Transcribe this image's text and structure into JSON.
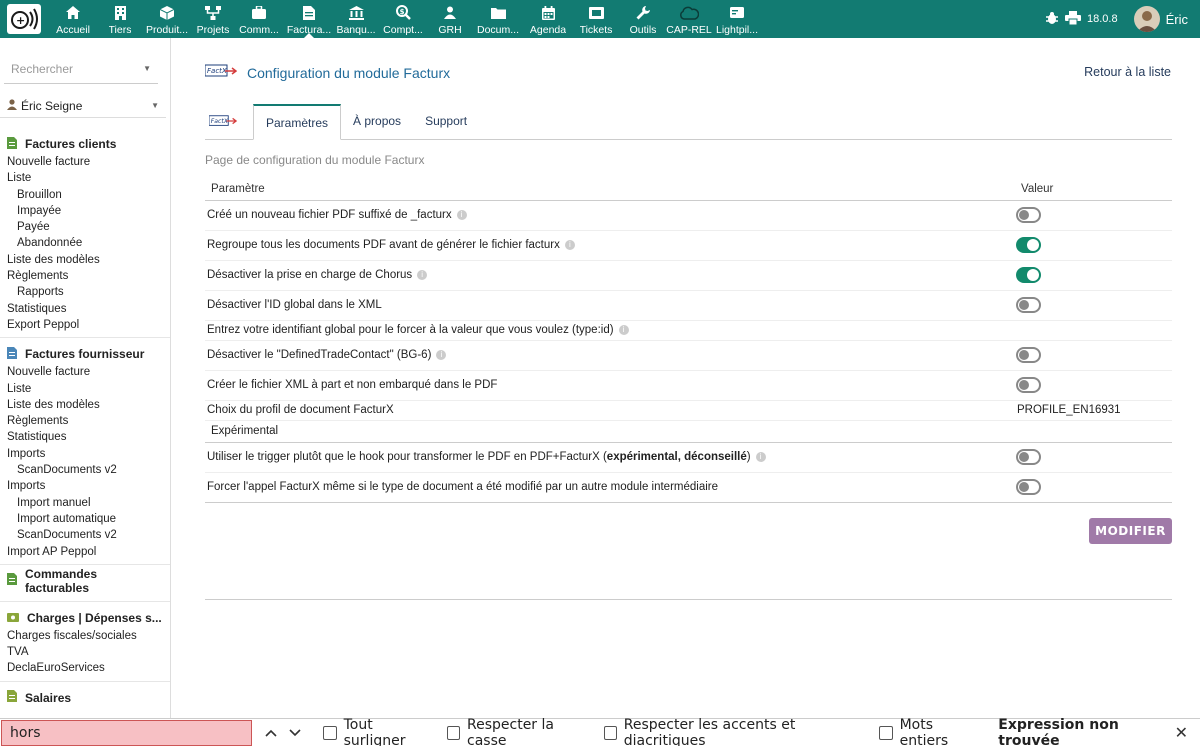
{
  "topbar": {
    "menu": [
      {
        "label": "Accueil",
        "icon": "home-icon"
      },
      {
        "label": "Tiers",
        "icon": "building-icon"
      },
      {
        "label": "Produit...",
        "icon": "cube-icon"
      },
      {
        "label": "Projets",
        "icon": "sitemap-icon"
      },
      {
        "label": "Comm...",
        "icon": "briefcase-icon"
      },
      {
        "label": "Factura...",
        "icon": "file-invoice-icon"
      },
      {
        "label": "Banqu...",
        "icon": "bank-icon"
      },
      {
        "label": "Compt...",
        "icon": "search-dollar-icon"
      },
      {
        "label": "GRH",
        "icon": "users-icon"
      },
      {
        "label": "Docum...",
        "icon": "folder-icon"
      },
      {
        "label": "Agenda",
        "icon": "calendar-icon"
      },
      {
        "label": "Tickets",
        "icon": "ticket-icon"
      },
      {
        "label": "Outils",
        "icon": "wrench-icon"
      },
      {
        "label": "CAP-REL",
        "icon": "cloud-icon"
      },
      {
        "label": "Lightpil...",
        "icon": "card-icon"
      }
    ],
    "version": "18.0.8",
    "user": "Éric"
  },
  "sidebar": {
    "search_placeholder": "Rechercher",
    "user": "Éric Seigne",
    "sections": [
      {
        "title": "Factures clients",
        "links": [
          {
            "label": "Nouvelle facture",
            "sub": false
          },
          {
            "label": "Liste",
            "sub": false
          },
          {
            "label": "Brouillon",
            "sub": true
          },
          {
            "label": "Impayée",
            "sub": true
          },
          {
            "label": "Payée",
            "sub": true
          },
          {
            "label": "Abandonnée",
            "sub": true
          },
          {
            "label": "Liste des modèles",
            "sub": false
          },
          {
            "label": "Règlements",
            "sub": false
          },
          {
            "label": "Rapports",
            "sub": true
          },
          {
            "label": "Statistiques",
            "sub": false
          },
          {
            "label": "Export Peppol",
            "sub": false
          }
        ]
      },
      {
        "title": "Factures fournisseur",
        "links": [
          {
            "label": "Nouvelle facture",
            "sub": false
          },
          {
            "label": "Liste",
            "sub": false
          },
          {
            "label": "Liste des modèles",
            "sub": false
          },
          {
            "label": "Règlements",
            "sub": false
          },
          {
            "label": "Statistiques",
            "sub": false
          },
          {
            "label": "Imports",
            "sub": false
          },
          {
            "label": "ScanDocuments v2",
            "sub": true
          },
          {
            "label": "Imports",
            "sub": false
          },
          {
            "label": "Import manuel",
            "sub": true
          },
          {
            "label": "Import automatique",
            "sub": true
          },
          {
            "label": "ScanDocuments v2",
            "sub": true
          },
          {
            "label": "Import AP Peppol",
            "sub": false
          }
        ]
      },
      {
        "title": "Commandes facturables",
        "links": []
      },
      {
        "title": "Charges | Dépenses s...",
        "links": [
          {
            "label": "Charges fiscales/sociales",
            "sub": false
          },
          {
            "label": "TVA",
            "sub": false
          },
          {
            "label": "DeclaEuroServices",
            "sub": false
          }
        ]
      },
      {
        "title": "Salaires",
        "links": []
      }
    ]
  },
  "main": {
    "title": "Configuration du module Facturx",
    "back_link": "Retour à la liste",
    "tabs": [
      "Paramètres",
      "À propos",
      "Support"
    ],
    "intro": "Page de configuration du module Facturx",
    "table": {
      "col_param": "Paramètre",
      "col_value": "Valeur",
      "rows": [
        {
          "label": "Créé un nouveau fichier PDF suffixé de _facturx",
          "info": true,
          "toggle": "off"
        },
        {
          "label": "Regroupe tous les documents PDF avant de générer le fichier facturx",
          "info": true,
          "toggle": "on"
        },
        {
          "label": "Désactiver la prise en charge de Chorus",
          "info": true,
          "toggle": "on"
        },
        {
          "label": "Désactiver l'ID global dans le XML",
          "info": false,
          "toggle": "off"
        },
        {
          "label": "Entrez votre identifiant global pour le forcer à la valeur que vous voulez (type:id)",
          "info": true,
          "toggle": null
        },
        {
          "label": "Désactiver le \"DefinedTradeContact\" (BG-6)",
          "info": true,
          "toggle": "off"
        },
        {
          "label": "Créer le fichier XML à part et non embarqué dans le PDF",
          "info": false,
          "toggle": "off"
        },
        {
          "label": "Choix du profil de document FacturX",
          "info": false,
          "value": "PROFILE_EN16931"
        }
      ],
      "section": "Expérimental",
      "exp_rows": [
        {
          "label_pre": "Utiliser le trigger plutôt que le hook pour transformer le PDF en PDF+FacturX (",
          "label_bold": "expérimental, déconseillé",
          "label_post": ")",
          "info": true,
          "toggle": "off"
        },
        {
          "label": "Forcer l'appel FacturX même si le type de document a été modifié par un autre module intermédiaire",
          "info": false,
          "toggle": "off"
        }
      ]
    },
    "modify_button": "MODIFIER"
  },
  "findbar": {
    "query": "hors",
    "options": [
      "Tout surligner",
      "Respecter la casse",
      "Respecter les accents et diacritiques",
      "Mots entiers"
    ],
    "status": "Expression non trouvée"
  },
  "colors": {
    "topbar": "#127b72",
    "toggle_on": "#128a6c",
    "modify_button": "#a07aa8",
    "find_input_bg": "#f7c0c4"
  }
}
